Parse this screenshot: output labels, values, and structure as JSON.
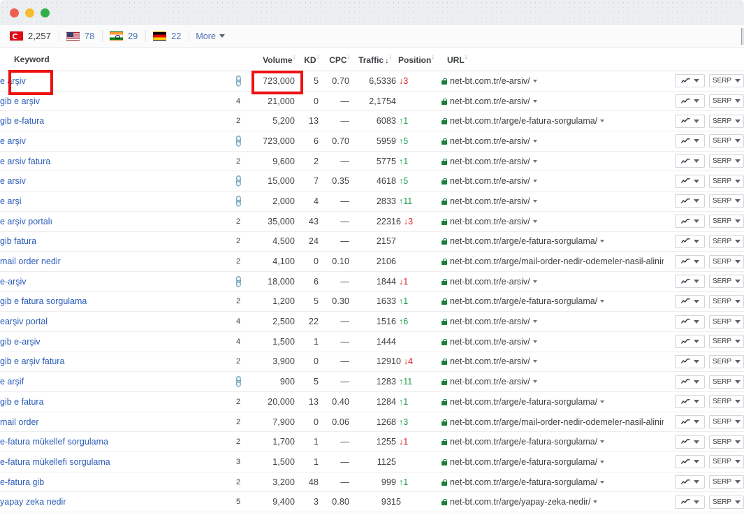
{
  "window": {
    "controls": [
      {
        "name": "close",
        "color": "#ed5f53"
      },
      {
        "name": "minimize",
        "color": "#f6bc2f"
      },
      {
        "name": "maximize",
        "color": "#33ad4a"
      }
    ]
  },
  "filter_bar": {
    "countries": [
      {
        "code": "tr",
        "name": "Turkey",
        "count": "2,257"
      },
      {
        "code": "us",
        "name": "United States",
        "count": "78"
      },
      {
        "code": "in",
        "name": "India",
        "count": "29"
      },
      {
        "code": "de",
        "name": "Germany",
        "count": "22"
      }
    ],
    "more_label": "More"
  },
  "table": {
    "columns": [
      {
        "key": "keyword",
        "label": "Keyword",
        "info": true,
        "sorted": false
      },
      {
        "key": "sf",
        "label": "",
        "info": false,
        "sorted": false
      },
      {
        "key": "volume",
        "label": "Volume",
        "info": true,
        "sorted": false
      },
      {
        "key": "kd",
        "label": "KD",
        "info": true,
        "sorted": false
      },
      {
        "key": "cpc",
        "label": "CPC",
        "info": true,
        "sorted": false
      },
      {
        "key": "traffic",
        "label": "Traffic",
        "info": true,
        "sorted": true,
        "sort_dir": "desc"
      },
      {
        "key": "position",
        "label": "Position",
        "info": true,
        "sorted": false
      },
      {
        "key": "url",
        "label": "URL",
        "info": true,
        "sorted": false
      }
    ],
    "info_icon": "i",
    "sort_icon": "↓",
    "action_buttons": {
      "chart_label": "",
      "serp_label": "SERP"
    },
    "rows": [
      {
        "keyword": "e arşiv",
        "sf": "link",
        "volume": "723,000",
        "kd": "5",
        "cpc": "0.70",
        "traffic": "6,533",
        "position": "6",
        "delta": "3",
        "delta_dir": "down",
        "url": "net-bt.com.tr/e-arsiv/"
      },
      {
        "keyword": "gib e arşiv",
        "sf": "4",
        "volume": "21,000",
        "kd": "0",
        "cpc": "—",
        "traffic": "2,175",
        "position": "4",
        "delta": "",
        "delta_dir": "",
        "url": "net-bt.com.tr/e-arsiv/"
      },
      {
        "keyword": "gib e-fatura",
        "sf": "2",
        "volume": "5,200",
        "kd": "13",
        "cpc": "—",
        "traffic": "608",
        "position": "3",
        "delta": "1",
        "delta_dir": "up",
        "url": "net-bt.com.tr/arge/e-fatura-sorgulama/"
      },
      {
        "keyword": "e arşiv",
        "sf": "link",
        "volume": "723,000",
        "kd": "6",
        "cpc": "0.70",
        "traffic": "595",
        "position": "9",
        "delta": "5",
        "delta_dir": "up",
        "url": "net-bt.com.tr/e-arsiv/"
      },
      {
        "keyword": "e arsiv fatura",
        "sf": "2",
        "volume": "9,600",
        "kd": "2",
        "cpc": "—",
        "traffic": "577",
        "position": "5",
        "delta": "1",
        "delta_dir": "up",
        "url": "net-bt.com.tr/e-arsiv/"
      },
      {
        "keyword": "e arsiv",
        "sf": "link",
        "volume": "15,000",
        "kd": "7",
        "cpc": "0.35",
        "traffic": "461",
        "position": "8",
        "delta": "5",
        "delta_dir": "up",
        "url": "net-bt.com.tr/e-arsiv/"
      },
      {
        "keyword": "e arşi",
        "sf": "link",
        "volume": "2,000",
        "kd": "4",
        "cpc": "—",
        "traffic": "283",
        "position": "3",
        "delta": "11",
        "delta_dir": "up",
        "url": "net-bt.com.tr/e-arsiv/"
      },
      {
        "keyword": "e arşiv portalı",
        "sf": "2",
        "volume": "35,000",
        "kd": "43",
        "cpc": "—",
        "traffic": "223",
        "position": "16",
        "delta": "3",
        "delta_dir": "down",
        "url": "net-bt.com.tr/e-arsiv/"
      },
      {
        "keyword": "gib fatura",
        "sf": "2",
        "volume": "4,500",
        "kd": "24",
        "cpc": "—",
        "traffic": "215",
        "position": "7",
        "delta": "",
        "delta_dir": "",
        "url": "net-bt.com.tr/arge/e-fatura-sorgulama/"
      },
      {
        "keyword": "mail order nedir",
        "sf": "2",
        "volume": "4,100",
        "kd": "0",
        "cpc": "0.10",
        "traffic": "210",
        "position": "6",
        "delta": "",
        "delta_dir": "",
        "url": "net-bt.com.tr/arge/mail-order-nedir-odemeler-nasil-alinir/"
      },
      {
        "keyword": "e-arşiv",
        "sf": "link",
        "volume": "18,000",
        "kd": "6",
        "cpc": "—",
        "traffic": "184",
        "position": "4",
        "delta": "1",
        "delta_dir": "down",
        "url": "net-bt.com.tr/e-arsiv/"
      },
      {
        "keyword": "gib e fatura sorgulama",
        "sf": "2",
        "volume": "1,200",
        "kd": "5",
        "cpc": "0.30",
        "traffic": "163",
        "position": "3",
        "delta": "1",
        "delta_dir": "up",
        "url": "net-bt.com.tr/arge/e-fatura-sorgulama/"
      },
      {
        "keyword": "earşiv portal",
        "sf": "4",
        "volume": "2,500",
        "kd": "22",
        "cpc": "—",
        "traffic": "151",
        "position": "6",
        "delta": "6",
        "delta_dir": "up",
        "url": "net-bt.com.tr/e-arsiv/"
      },
      {
        "keyword": "gib e-arşiv",
        "sf": "4",
        "volume": "1,500",
        "kd": "1",
        "cpc": "—",
        "traffic": "144",
        "position": "4",
        "delta": "",
        "delta_dir": "",
        "url": "net-bt.com.tr/e-arsiv/"
      },
      {
        "keyword": "gib e arşiv fatura",
        "sf": "2",
        "volume": "3,900",
        "kd": "0",
        "cpc": "—",
        "traffic": "129",
        "position": "10",
        "delta": "4",
        "delta_dir": "down",
        "url": "net-bt.com.tr/e-arsiv/"
      },
      {
        "keyword": "e arşif",
        "sf": "link",
        "volume": "900",
        "kd": "5",
        "cpc": "—",
        "traffic": "128",
        "position": "3",
        "delta": "11",
        "delta_dir": "up",
        "url": "net-bt.com.tr/e-arsiv/"
      },
      {
        "keyword": "gib e fatura",
        "sf": "2",
        "volume": "20,000",
        "kd": "13",
        "cpc": "0.40",
        "traffic": "128",
        "position": "4",
        "delta": "1",
        "delta_dir": "up",
        "url": "net-bt.com.tr/arge/e-fatura-sorgulama/"
      },
      {
        "keyword": "mail order",
        "sf": "2",
        "volume": "7,900",
        "kd": "0",
        "cpc": "0.06",
        "traffic": "126",
        "position": "8",
        "delta": "3",
        "delta_dir": "up",
        "url": "net-bt.com.tr/arge/mail-order-nedir-odemeler-nasil-alinir/"
      },
      {
        "keyword": "e-fatura mükellef sorgulama",
        "sf": "2",
        "volume": "1,700",
        "kd": "1",
        "cpc": "—",
        "traffic": "125",
        "position": "5",
        "delta": "1",
        "delta_dir": "down",
        "url": "net-bt.com.tr/arge/e-fatura-sorgulama/"
      },
      {
        "keyword": "e-fatura mükellefi sorgulama",
        "sf": "3",
        "volume": "1,500",
        "kd": "1",
        "cpc": "—",
        "traffic": "112",
        "position": "5",
        "delta": "",
        "delta_dir": "",
        "url": "net-bt.com.tr/arge/e-fatura-sorgulama/"
      },
      {
        "keyword": "e-fatura gib",
        "sf": "2",
        "volume": "3,200",
        "kd": "48",
        "cpc": "—",
        "traffic": "99",
        "position": "9",
        "delta": "1",
        "delta_dir": "up",
        "url": "net-bt.com.tr/arge/e-fatura-sorgulama/"
      },
      {
        "keyword": "yapay zeka nedir",
        "sf": "5",
        "volume": "9,400",
        "kd": "3",
        "cpc": "0.80",
        "traffic": "93",
        "position": "15",
        "delta": "",
        "delta_dir": "",
        "url": "net-bt.com.tr/arge/yapay-zeka-nedir/"
      }
    ]
  },
  "annotations": [
    {
      "name": "keyword-highlight",
      "color": "#ee1111"
    },
    {
      "name": "volume-highlight",
      "color": "#ee1111"
    }
  ]
}
